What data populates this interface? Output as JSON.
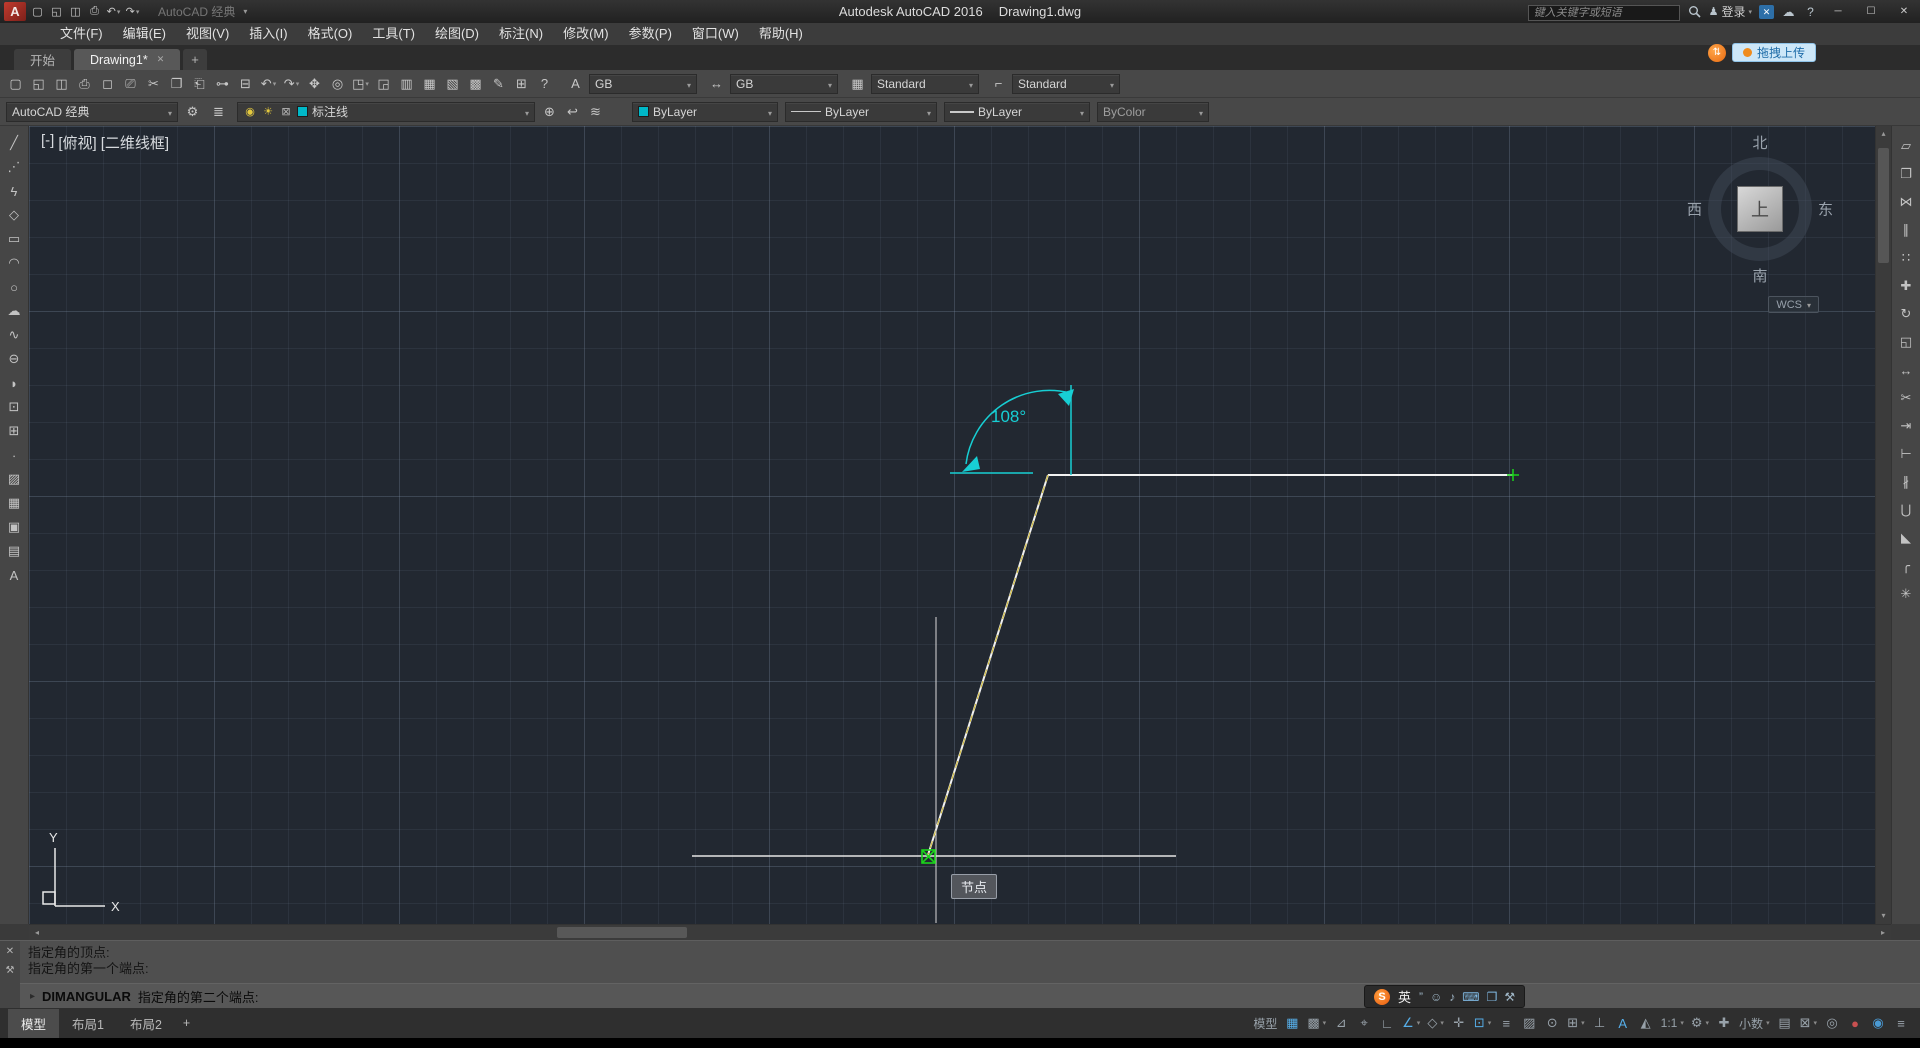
{
  "glyphs": {
    "caret": "▾",
    "close": "✕",
    "cloud": "☁",
    "minimize": "─",
    "maximize": "☐",
    "wrench": "⚒",
    "prompt_arrow": "▸",
    "scroll_left": "◂",
    "scroll_right": "▸",
    "scroll_up": "▴",
    "scroll_down": "▾",
    "sync": "⇅",
    "person": "♟"
  },
  "colors": {
    "accent_blue": "#56aee8",
    "layer_cyan": "#00b8c8",
    "dimension_cyan": "#17cfd4",
    "node_green": "#1bd41b",
    "tracking_yellow": "#cdb62e",
    "upload_orange": "#f08c1e"
  },
  "title_bar": {
    "logo_letter": "A",
    "app_title": "Autodesk AutoCAD 2016",
    "doc_title": "Drawing1.dwg",
    "workspace": "AutoCAD 经典",
    "search_placeholder": "键入关键字或短语",
    "signin_label": "登录",
    "help_label": "?",
    "qat_icons": [
      {
        "name": "qnew-icon",
        "glyph": "▢"
      },
      {
        "name": "open-icon",
        "glyph": "◱"
      },
      {
        "name": "save-icon",
        "glyph": "◫"
      },
      {
        "name": "plot-icon",
        "glyph": "⎙"
      },
      {
        "name": "undo-button",
        "glyph": "↶",
        "caret": true
      },
      {
        "name": "redo-button",
        "glyph": "↷",
        "caret": true
      }
    ]
  },
  "menu_bar": {
    "items": [
      "文件(F)",
      "编辑(E)",
      "视图(V)",
      "插入(I)",
      "格式(O)",
      "工具(T)",
      "绘图(D)",
      "标注(N)",
      "修改(M)",
      "参数(P)",
      "窗口(W)",
      "帮助(H)"
    ]
  },
  "tab_row": {
    "tabs": [
      {
        "label": "开始"
      },
      {
        "label": "Drawing1*",
        "active": true
      }
    ],
    "new_tab_label": "+",
    "upload_label": "拖拽上传"
  },
  "toolbar_standard": {
    "icons": [
      {
        "name": "qnew-icon",
        "glyph": "▢"
      },
      {
        "name": "open-icon",
        "glyph": "◱"
      },
      {
        "name": "save-icon",
        "glyph": "◫"
      },
      {
        "name": "plot-icon",
        "glyph": "⎙"
      },
      {
        "name": "plot-preview-icon",
        "glyph": "◻"
      },
      {
        "name": "publish-icon",
        "glyph": "⎚"
      },
      {
        "name": "cut-icon",
        "glyph": "✂"
      },
      {
        "name": "copy-clip-icon",
        "glyph": "❐"
      },
      {
        "name": "paste-icon",
        "glyph": "⎗"
      },
      {
        "name": "match-properties-icon",
        "glyph": "⊶"
      },
      {
        "name": "block-editor-icon",
        "glyph": "⊟"
      },
      {
        "name": "undo-button",
        "glyph": "↶",
        "caret": true
      },
      {
        "name": "redo-button",
        "glyph": "↷",
        "caret": true
      },
      {
        "name": "pan-icon",
        "glyph": "✥"
      },
      {
        "name": "zoom-realtime-icon",
        "glyph": "◎"
      },
      {
        "name": "zoom-window-icon",
        "glyph": "◳",
        "caret": true
      },
      {
        "name": "zoom-previous-icon",
        "glyph": "◲"
      },
      {
        "name": "properties-palette-icon",
        "glyph": "▥"
      },
      {
        "name": "designcenter-icon",
        "glyph": "▦"
      },
      {
        "name": "tool-palettes-icon",
        "glyph": "▧"
      },
      {
        "name": "sheet-set-manager-icon",
        "glyph": "▩"
      },
      {
        "name": "markup-icon",
        "glyph": "✎"
      },
      {
        "name": "quickcalc-icon",
        "glyph": "⊞"
      },
      {
        "name": "help-icon",
        "glyph": "?"
      }
    ],
    "styles": [
      {
        "name": "text-style-combo",
        "icon_name": "text-style-icon",
        "icon": "A",
        "value": "GB"
      },
      {
        "name": "dim-style-combo",
        "icon_name": "dim-style-icon",
        "icon": "↔",
        "value": "GB"
      },
      {
        "name": "table-style-combo",
        "icon_name": "table-style-icon",
        "icon": "▦",
        "value": "Standard"
      },
      {
        "name": "mleader-style-combo",
        "icon_name": "mleader-style-icon",
        "icon": "⌐",
        "value": "Standard"
      }
    ]
  },
  "toolbar_layers": {
    "workspace_value": "AutoCAD 经典",
    "gear_glyph": "⚙",
    "layer_manager_glyph": "≣",
    "status_icons": [
      "◉",
      "☀",
      "⊠"
    ],
    "layer_value": "标注线",
    "tool_icons": [
      {
        "name": "make-object-layer-current-icon",
        "glyph": "⊕"
      },
      {
        "name": "layer-previous-icon",
        "glyph": "↩"
      },
      {
        "name": "layer-states-icon",
        "glyph": "≋"
      }
    ],
    "color_value": "ByLayer",
    "linetype_value": "ByLayer",
    "lineweight_value": "ByLayer",
    "plotstyle_value": "ByColor"
  },
  "draw_toolbar": {
    "tools": [
      {
        "name": "line-tool-icon",
        "glyph": "╱"
      },
      {
        "name": "construction-line-tool-icon",
        "glyph": "⋰"
      },
      {
        "name": "polyline-tool-icon",
        "glyph": "ϟ"
      },
      {
        "name": "polygon-tool-icon",
        "glyph": "◇"
      },
      {
        "name": "rectangle-tool-icon",
        "glyph": "▭"
      },
      {
        "name": "arc-tool-icon",
        "glyph": "◠"
      },
      {
        "name": "circle-tool-icon",
        "glyph": "○"
      },
      {
        "name": "revision-cloud-tool-icon",
        "glyph": "☁"
      },
      {
        "name": "spline-tool-icon",
        "glyph": "∿"
      },
      {
        "name": "ellipse-tool-icon",
        "glyph": "⊖"
      },
      {
        "name": "ellipse-arc-tool-icon",
        "glyph": "◗"
      },
      {
        "name": "insert-block-tool-icon",
        "glyph": "⊡"
      },
      {
        "name": "create-block-tool-icon",
        "glyph": "⊞"
      },
      {
        "name": "point-tool-icon",
        "glyph": "∙"
      },
      {
        "name": "hatch-tool-icon",
        "glyph": "▨"
      },
      {
        "name": "gradient-tool-icon",
        "glyph": "▦"
      },
      {
        "name": "region-tool-icon",
        "glyph": "▣"
      },
      {
        "name": "table-tool-icon",
        "glyph": "▤"
      },
      {
        "name": "multiline-text-tool-icon",
        "glyph": "A"
      }
    ]
  },
  "modify_toolbar": {
    "tools": [
      {
        "name": "erase-tool-icon",
        "glyph": "▱"
      },
      {
        "name": "copy-tool-icon",
        "glyph": "❐"
      },
      {
        "name": "mirror-tool-icon",
        "glyph": "⋈"
      },
      {
        "name": "offset-tool-icon",
        "glyph": "∥"
      },
      {
        "name": "array-tool-icon",
        "glyph": "∷"
      },
      {
        "name": "move-tool-icon",
        "glyph": "✚"
      },
      {
        "name": "rotate-tool-icon",
        "glyph": "↻"
      },
      {
        "name": "scale-tool-icon",
        "glyph": "◱"
      },
      {
        "name": "stretch-tool-icon",
        "glyph": "↔"
      },
      {
        "name": "trim-tool-icon",
        "glyph": "✂"
      },
      {
        "name": "extend-tool-icon",
        "glyph": "⇥"
      },
      {
        "name": "break-at-point-tool-icon",
        "glyph": "⊢"
      },
      {
        "name": "break-tool-icon",
        "glyph": "∦"
      },
      {
        "name": "join-tool-icon",
        "glyph": "⋃"
      },
      {
        "name": "chamfer-tool-icon",
        "glyph": "◣"
      },
      {
        "name": "fillet-tool-icon",
        "glyph": "╭"
      },
      {
        "name": "explode-tool-icon",
        "glyph": "✳"
      }
    ]
  },
  "canvas": {
    "viewport_controls": [
      "[-]",
      "[俯视]",
      "[二维线框]"
    ],
    "viewcube": {
      "north": "北",
      "south": "南",
      "west": "西",
      "east": "东",
      "top": "上",
      "wcs": "WCS"
    },
    "dimension_value": "108°",
    "snap_tooltip": "节点",
    "ucs": {
      "x_label": "X",
      "y_label": "Y"
    }
  },
  "command_line": {
    "history": [
      "指定角的顶点:",
      "指定角的第一个端点:"
    ],
    "command": "DIMANGULAR",
    "prompt": "指定角的第二个端点:"
  },
  "status_bar": {
    "layout_tabs": [
      {
        "label": "模型",
        "active": true
      },
      {
        "label": "布局1"
      },
      {
        "label": "布局2"
      }
    ],
    "new_layout_label": "+",
    "toggles": [
      {
        "name": "model-paper-toggle",
        "label": "模型"
      },
      {
        "name": "grid-toggle",
        "glyph": "▦",
        "active": true
      },
      {
        "name": "snap-toggle",
        "glyph": "▩",
        "caret": true
      },
      {
        "name": "infer-constraints-toggle",
        "glyph": "⊿"
      },
      {
        "name": "dynamic-input-toggle",
        "glyph": "⌖"
      },
      {
        "name": "ortho-toggle",
        "glyph": "∟"
      },
      {
        "name": "polar-tracking-toggle",
        "glyph": "∠",
        "active": true,
        "caret": true
      },
      {
        "name": "isodraft-toggle",
        "glyph": "◇",
        "caret": true
      },
      {
        "name": "object-snap-tracking-toggle",
        "glyph": "✛"
      },
      {
        "name": "object-snap-toggle",
        "glyph": "⊡",
        "active": true,
        "caret": true
      },
      {
        "name": "lineweight-display-toggle",
        "glyph": "≡"
      },
      {
        "name": "transparency-toggle",
        "glyph": "▨"
      },
      {
        "name": "selection-cycling-toggle",
        "glyph": "⊙"
      },
      {
        "name": "3d-object-snap-toggle",
        "glyph": "⊞",
        "caret": true
      },
      {
        "name": "dynamic-ucs-toggle",
        "glyph": "⊥"
      },
      {
        "name": "annotation-visibility-toggle",
        "glyph": "A",
        "active": true
      },
      {
        "name": "autoscale-toggle",
        "glyph": "◭"
      },
      {
        "name": "annotation-scale-button",
        "label": "1:1",
        "caret": true
      },
      {
        "name": "workspace-switching-button",
        "glyph": "⚙",
        "caret": true
      },
      {
        "name": "annotation-monitor-toggle",
        "glyph": "✚"
      },
      {
        "name": "units-button",
        "label": "小数",
        "caret": true
      },
      {
        "name": "quick-properties-toggle",
        "glyph": "▤"
      },
      {
        "name": "lock-ui-button",
        "glyph": "⊠",
        "caret": true
      },
      {
        "name": "isolate-objects-button",
        "glyph": "◎"
      },
      {
        "name": "graphics-performance-toggle",
        "glyph": "●",
        "color": "#c85050"
      },
      {
        "name": "clean-screen-toggle",
        "glyph": "◉",
        "color": "#4a9ad4"
      },
      {
        "name": "customization-button",
        "glyph": "≡"
      }
    ]
  },
  "ime_bar": {
    "logo": "S",
    "lang": "英",
    "icons": [
      {
        "name": "ime-punctuation-icon",
        "glyph": "”"
      },
      {
        "name": "ime-emoji-icon",
        "glyph": "☺"
      },
      {
        "name": "ime-voice-icon",
        "glyph": "♪"
      },
      {
        "name": "ime-keyboard-icon",
        "glyph": "⌨",
        "color": "#7fb7e0"
      },
      {
        "name": "ime-clipboard-icon",
        "glyph": "❐",
        "color": "#7fb7e0"
      },
      {
        "name": "ime-toolbox-icon",
        "glyph": "⚒"
      }
    ]
  }
}
